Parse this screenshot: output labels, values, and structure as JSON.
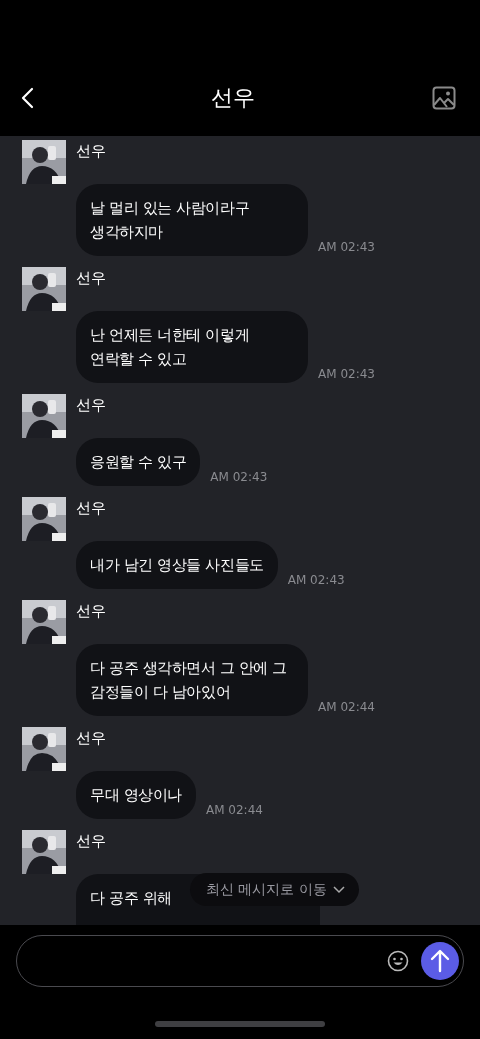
{
  "header": {
    "title": "선우"
  },
  "messages": [
    {
      "sender": "선우",
      "text": "날 멀리 있는 사람이라구 생각하지마",
      "time": "AM 02:43"
    },
    {
      "sender": "선우",
      "text": "난 언제든 너한테 이렇게 연락할 수 있고",
      "time": "AM 02:43"
    },
    {
      "sender": "선우",
      "text": "응원할 수 있구",
      "time": "AM 02:43"
    },
    {
      "sender": "선우",
      "text": "내가 남긴 영상들 사진들도",
      "time": "AM 02:43"
    },
    {
      "sender": "선우",
      "text": "다 공주 생각하면서 그 안에 그 감정들이 다 남아있어",
      "time": "AM 02:44"
    },
    {
      "sender": "선우",
      "text": "무대 영상이나",
      "time": "AM 02:44"
    },
    {
      "sender": "선우",
      "text": "다 공주 위해"
    }
  ],
  "jump_pill": {
    "label": "최신 메시지로 이동"
  }
}
